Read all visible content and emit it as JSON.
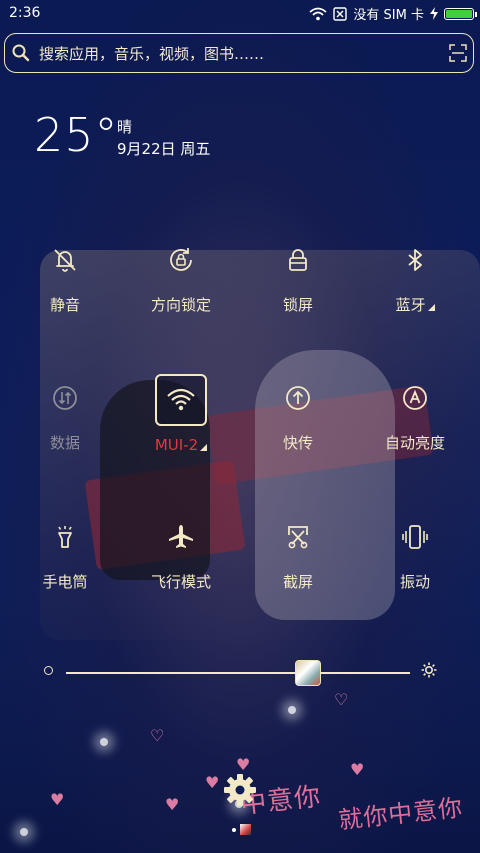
{
  "status_bar": {
    "time": "2:36",
    "sim_text": "没有 SIM 卡",
    "battery_level": 1.0
  },
  "search": {
    "placeholder": "搜索应用，音乐，视频，图书……"
  },
  "weather": {
    "temperature": "25°",
    "condition": "晴",
    "date": "9月22日 周五"
  },
  "toggles": [
    {
      "label": "静音",
      "icon": "bell-off-icon",
      "state": "off"
    },
    {
      "label": "方向锁定",
      "icon": "rotation-lock-icon",
      "state": "off"
    },
    {
      "label": "锁屏",
      "icon": "lock-icon",
      "state": "off"
    },
    {
      "label": "蓝牙",
      "icon": "bluetooth-icon",
      "state": "off"
    },
    {
      "label": "数据",
      "icon": "mobile-data-icon",
      "state": "disabled"
    },
    {
      "label": "MUI-2",
      "icon": "wifi-icon",
      "state": "on"
    },
    {
      "label": "快传",
      "icon": "share-upload-icon",
      "state": "off"
    },
    {
      "label": "自动亮度",
      "icon": "auto-brightness-icon",
      "state": "off"
    },
    {
      "label": "手电筒",
      "icon": "flashlight-icon",
      "state": "off"
    },
    {
      "label": "飞行模式",
      "icon": "airplane-icon",
      "state": "off"
    },
    {
      "label": "截屏",
      "icon": "screenshot-icon",
      "state": "off"
    },
    {
      "label": "振动",
      "icon": "vibrate-icon",
      "state": "off"
    }
  ],
  "brightness": {
    "level": 0.7
  },
  "wallpaper_text": [
    "中意你",
    "就你中意你"
  ],
  "colors": {
    "accent": "#f3e9c6",
    "wifi_label": "#e23a3a",
    "background": "#0d1d5a"
  }
}
